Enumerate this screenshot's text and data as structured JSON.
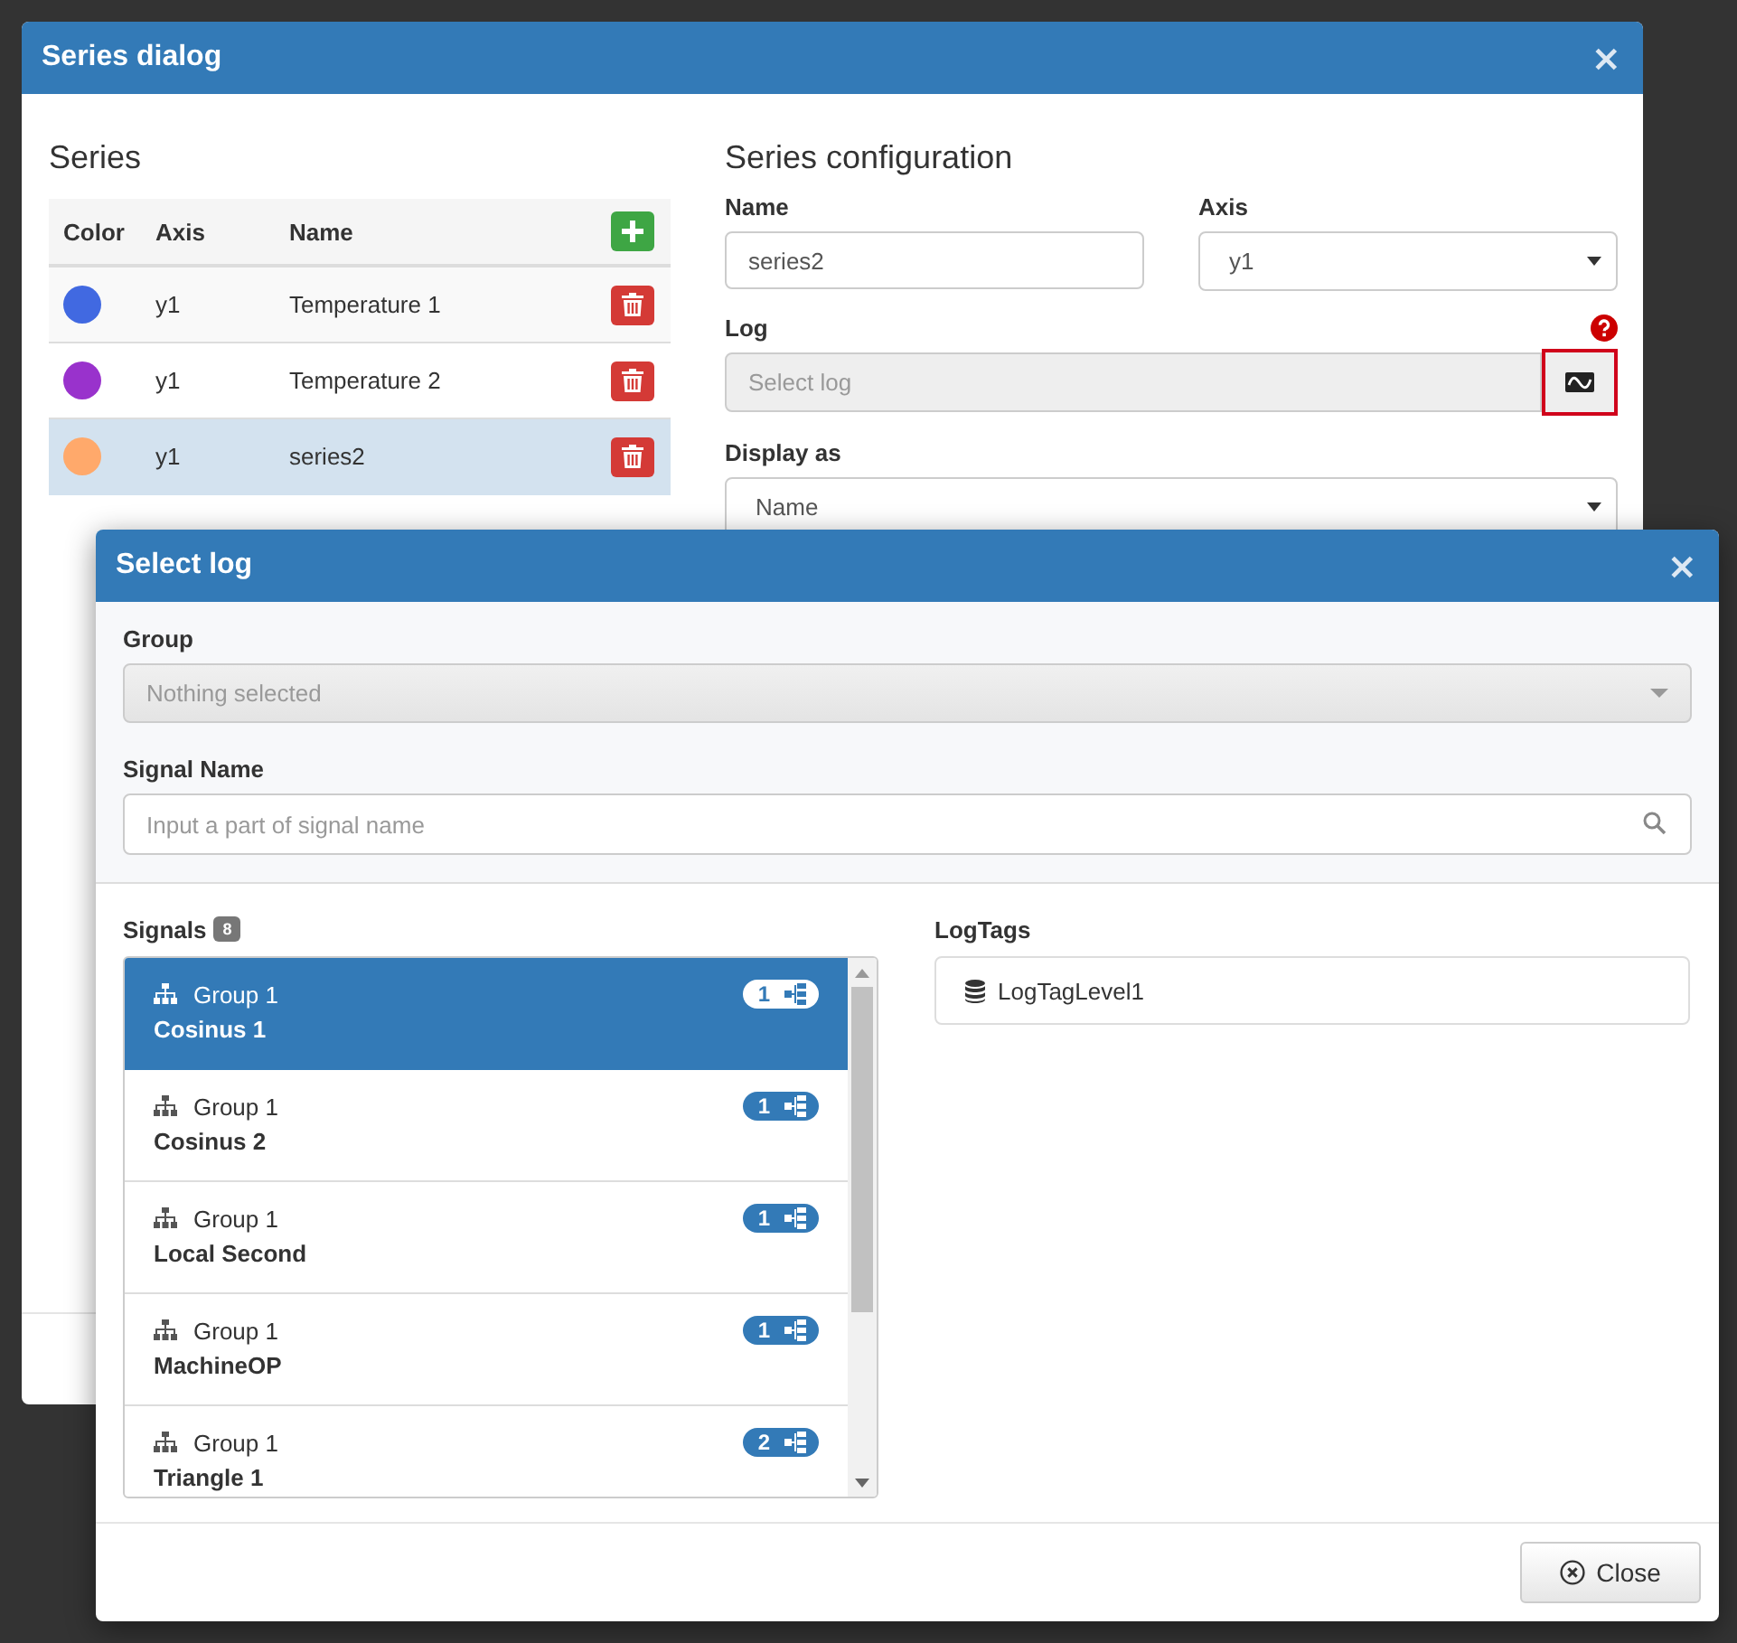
{
  "series_dialog": {
    "title": "Series dialog",
    "close": "×",
    "series": {
      "heading": "Series",
      "columns": [
        "Color",
        "Axis",
        "Name"
      ],
      "rows": [
        {
          "color": "#4169e1",
          "axis": "y1",
          "name": "Temperature 1",
          "selected": false
        },
        {
          "color": "#9932cc",
          "axis": "y1",
          "name": "Temperature 2",
          "selected": false
        },
        {
          "color": "#ffa96b",
          "axis": "y1",
          "name": "series2",
          "selected": true
        }
      ]
    },
    "config": {
      "heading": "Series configuration",
      "name_label": "Name",
      "name_value": "series2",
      "axis_label": "Axis",
      "axis_value": "y1",
      "log_label": "Log",
      "log_placeholder": "Select log",
      "display_label": "Display as",
      "display_value": "Name"
    }
  },
  "select_log_dialog": {
    "title": "Select log",
    "close": "×",
    "group_label": "Group",
    "group_value": "Nothing selected",
    "signal_label": "Signal Name",
    "signal_placeholder": "Input a part of signal name",
    "signals_label": "Signals",
    "signals_count": "8",
    "signals": [
      {
        "group": "Group 1",
        "name": "Cosinus 1",
        "count": "1",
        "selected": true
      },
      {
        "group": "Group 1",
        "name": "Cosinus 2",
        "count": "1",
        "selected": false
      },
      {
        "group": "Group 1",
        "name": "Local Second",
        "count": "1",
        "selected": false
      },
      {
        "group": "Group 1",
        "name": "MachineOP",
        "count": "1",
        "selected": false
      },
      {
        "group": "Group 1",
        "name": "Triangle 1",
        "count": "2",
        "selected": false
      }
    ],
    "logtags_label": "LogTags",
    "logtags": [
      {
        "name": "LogTagLevel1"
      }
    ],
    "close_button": "Close"
  }
}
